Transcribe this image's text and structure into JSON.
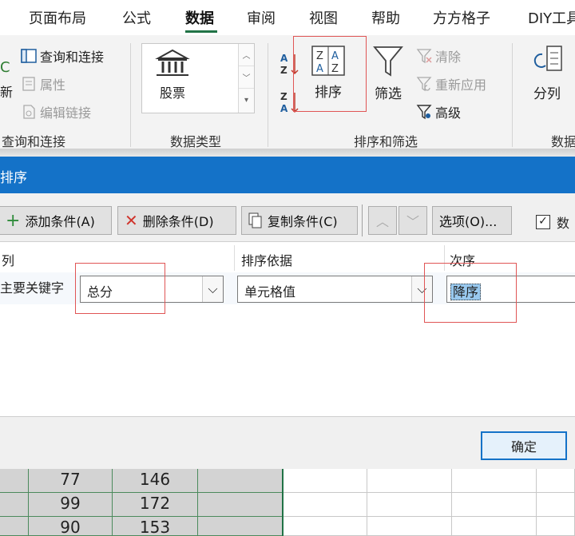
{
  "ribbon_tabs": [
    "页面布局",
    "公式",
    "数据",
    "审阅",
    "视图",
    "帮助",
    "方方格子",
    "DIY工具"
  ],
  "active_tab": "数据",
  "ribbon": {
    "refresh_partial": "新",
    "refresh_icon_char": "C",
    "queries_group": {
      "query_connect": "查询和连接",
      "properties": "属性",
      "edit_links": "编辑链接",
      "label": "查询和连接"
    },
    "data_types_group": {
      "stocks": "股票",
      "label": "数据类型"
    },
    "sort_filter_group": {
      "sort": "排序",
      "filter": "筛选",
      "clear": "清除",
      "reapply": "重新应用",
      "advanced": "高级",
      "label": "排序和筛选"
    },
    "data_tools_group": {
      "text_to_columns": "分列",
      "label_partial": "数据"
    }
  },
  "dialog": {
    "title": "排序",
    "toolbar": {
      "add_condition": "添加条件(A)",
      "delete_condition": "删除条件(D)",
      "copy_condition": "复制条件(C)",
      "options": "选项(O)...",
      "header_checkbox_partial": "数"
    },
    "columns": {
      "col": "列",
      "sort_on": "排序依据",
      "order": "次序"
    },
    "row": {
      "label": "主要关键字",
      "column_value": "总分",
      "sort_on_value": "单元格值",
      "order_value": "降序"
    },
    "ok": "确定"
  },
  "sheet_rows": [
    {
      "b": "77",
      "c": "146"
    },
    {
      "b": "99",
      "c": "172"
    },
    {
      "b": "90",
      "c": "153"
    }
  ],
  "colors": {
    "accent": "#217346",
    "dialog_title": "#1472c8",
    "highlight_box": "#e05555",
    "selection": "#99c9ef"
  }
}
